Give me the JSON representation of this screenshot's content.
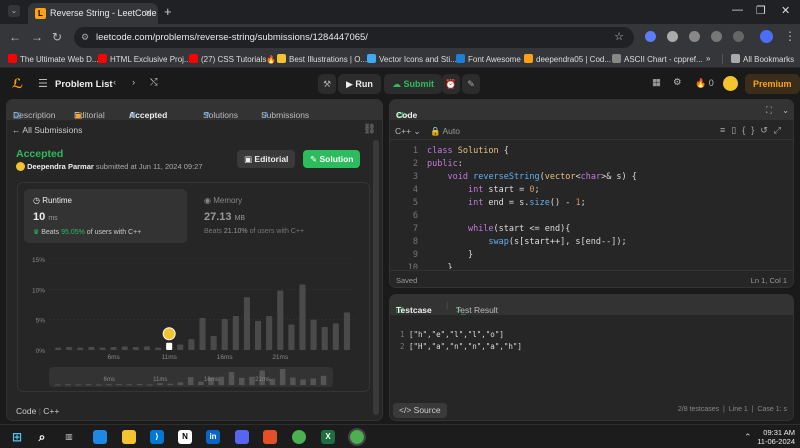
{
  "browser": {
    "tab_title": "Reverse String - LeetCode",
    "url": "leetcode.com/problems/reverse-string/submissions/1284447065/",
    "bookmarks": [
      {
        "label": "The Ultimate Web D...",
        "color": "#ff0000"
      },
      {
        "label": "HTML Exclusive Proj...",
        "color": "#ff0000"
      },
      {
        "label": "(27) CSS Tutorials🔥...",
        "color": "#ff0000"
      },
      {
        "label": "Best Illustrations | O...",
        "color": "#f4c430"
      },
      {
        "label": "Vector Icons and Sti...",
        "color": "#3fa9f5"
      },
      {
        "label": "Font Awesome",
        "color": "#1c7ed6"
      },
      {
        "label": "deependra05 | Cod...",
        "color": "#ffa116"
      },
      {
        "label": "ASCII Chart - cppref...",
        "color": "#888888"
      }
    ],
    "all_bookmarks": "All Bookmarks",
    "more": "»"
  },
  "lc_nav": {
    "problem_list": "Problem List",
    "run": "Run",
    "submit": "Submit",
    "streak": "0",
    "premium": "Premium"
  },
  "left_tabs": {
    "description": "Description",
    "editorial": "Editorial",
    "accepted": "Accepted",
    "solutions": "Solutions",
    "submissions": "Submissions"
  },
  "submission": {
    "back": "All Submissions",
    "status": "Accepted",
    "user": "Deependra Parmar",
    "submitted_at": "submitted at Jun 11, 2024 09:27",
    "editorial_btn": "Editorial",
    "solution_btn": "Solution",
    "runtime_label": "Runtime",
    "runtime_value": "10",
    "runtime_unit": "ms",
    "runtime_beats_prefix": "Beats",
    "runtime_beats": "95.05%",
    "runtime_beats_suffix": "of users with C++",
    "memory_label": "Memory",
    "memory_value": "27.13",
    "memory_unit": "MB",
    "memory_beats_prefix": "Beats",
    "memory_beats": "21.10%",
    "memory_beats_suffix": "of users with C++",
    "code_label": "Code",
    "lang": "C++"
  },
  "chart_data": {
    "type": "bar",
    "yticks": [
      "15%",
      "10%",
      "5%",
      "0%"
    ],
    "xticks": [
      "6ms",
      "11ms",
      "16ms",
      "21ms"
    ],
    "ylim": [
      0,
      15
    ],
    "values": [
      0.4,
      0.5,
      0.4,
      0.5,
      0.4,
      0.5,
      0.6,
      0.5,
      0.6,
      0.4,
      1.2,
      0.9,
      1.8,
      5.3,
      2.3,
      5.1,
      5.6,
      8.7,
      4.8,
      5.6,
      9.8,
      4.2,
      10.8,
      5.0,
      3.8,
      4.4,
      6.2
    ],
    "highlight_index": 10
  },
  "code_panel": {
    "title": "Code",
    "lang": "C++",
    "mode": "Auto",
    "lines": [
      "1",
      "2",
      "3",
      "4",
      "5",
      "6",
      "7",
      "8",
      "9",
      "10"
    ],
    "status": "Saved",
    "position": "Ln 1, Col 1"
  },
  "test_panel": {
    "testcase": "Testcase",
    "result": "Test Result",
    "cases": [
      "[\"h\",\"e\",\"l\",\"l\",\"o\"]",
      "[\"H\",\"a\",\"n\",\"n\",\"a\",\"h\"]"
    ],
    "case_nums": [
      "1",
      "2"
    ],
    "source": "Source",
    "footer": "2/8 testcases  |  Line 1  |  Case 1: s"
  },
  "taskbar": {
    "time": "09:31 AM",
    "date": "11-06-2024"
  }
}
